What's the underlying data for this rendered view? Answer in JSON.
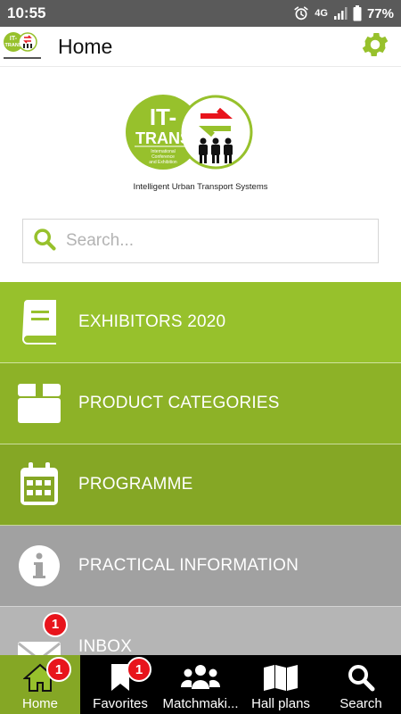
{
  "status_bar": {
    "time": "10:55",
    "network": "4G",
    "battery": "77%"
  },
  "app_bar": {
    "title": "Home",
    "logo_text": "IT-TRANS",
    "logo_caption": "Intelligent Urban Transport Systems"
  },
  "hero": {
    "logo_text_line1": "IT-",
    "logo_text_line2": "TRANS",
    "logo_subtext": [
      "International",
      "Conference",
      "and Exhibition"
    ],
    "caption": "Intelligent Urban Transport Systems"
  },
  "search": {
    "placeholder": "Search..."
  },
  "menu": {
    "items": [
      {
        "label": "EXHIBITORS 2020",
        "icon": "book-icon"
      },
      {
        "label": "PRODUCT CATEGORIES",
        "icon": "box-icon"
      },
      {
        "label": "PROGRAMME",
        "icon": "calendar-icon"
      },
      {
        "label": "PRACTICAL INFORMATION",
        "icon": "info-icon"
      },
      {
        "label": "INBOX",
        "icon": "envelope-icon",
        "badge": "1"
      }
    ]
  },
  "bottom_nav": {
    "items": [
      {
        "label": "Home",
        "icon": "home-icon",
        "badge": "1",
        "active": true
      },
      {
        "label": "Favorites",
        "icon": "bookmark-icon",
        "badge": "1"
      },
      {
        "label": "Matchmaki...",
        "icon": "people-icon"
      },
      {
        "label": "Hall plans",
        "icon": "map-icon"
      },
      {
        "label": "Search",
        "icon": "search-icon"
      }
    ]
  },
  "colors": {
    "brand_green": "#97c12c",
    "status_bar": "#5a5a5a",
    "badge_red": "#e8141c"
  }
}
